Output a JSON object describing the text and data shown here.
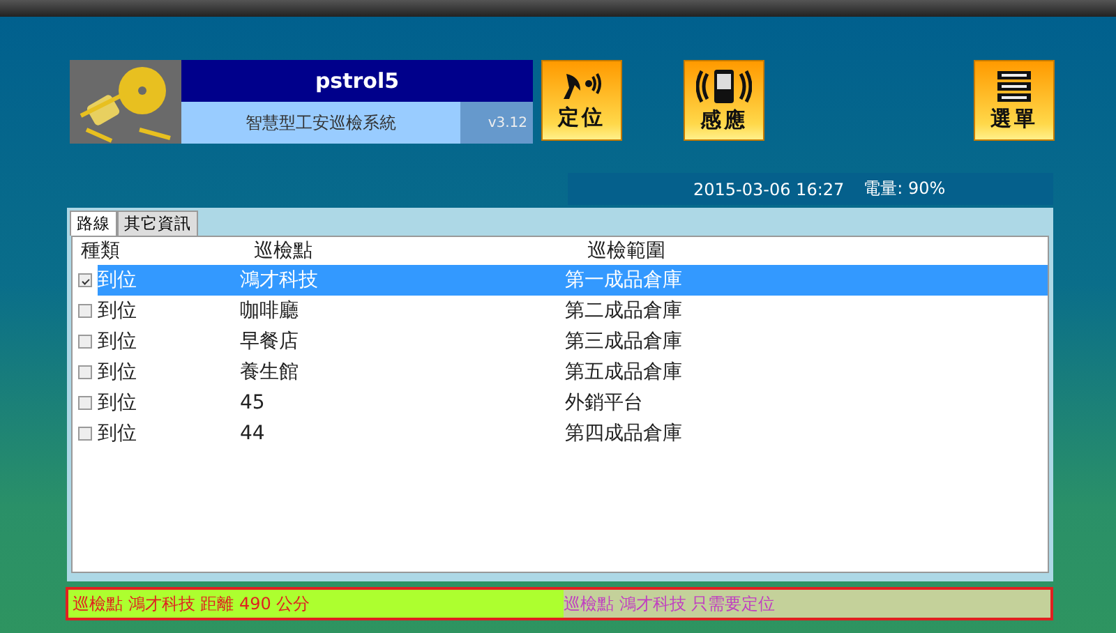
{
  "app": {
    "title": "pstrol5",
    "subtitle": "智慧型工安巡檢系統",
    "version": "v3.12"
  },
  "toolbar": [
    {
      "kind": "locate",
      "label": "定位"
    },
    {
      "kind": "sense",
      "label": "感應"
    },
    {
      "kind": "menu",
      "label": "選單"
    }
  ],
  "status": {
    "datetime": "2015-03-06 16:27",
    "battery": "電量: 90%"
  },
  "tabs": [
    {
      "label": "路線",
      "selected": true
    },
    {
      "label": "其它資訊",
      "selected": false
    }
  ],
  "table": {
    "columns": [
      "種類",
      "巡檢點",
      "巡檢範圍"
    ],
    "rows": [
      {
        "checked": true,
        "selected": true,
        "cells": [
          "到位",
          "鴻才科技",
          "第一成品倉庫"
        ]
      },
      {
        "checked": false,
        "selected": false,
        "cells": [
          "到位",
          "咖啡廳",
          "第二成品倉庫"
        ]
      },
      {
        "checked": false,
        "selected": false,
        "cells": [
          "到位",
          "早餐店",
          "第三成品倉庫"
        ]
      },
      {
        "checked": false,
        "selected": false,
        "cells": [
          "到位",
          "養生館",
          "第五成品倉庫"
        ]
      },
      {
        "checked": false,
        "selected": false,
        "cells": [
          "到位",
          "45",
          "外銷平台"
        ]
      },
      {
        "checked": false,
        "selected": false,
        "cells": [
          "到位",
          "44",
          "第四成品倉庫"
        ]
      }
    ]
  },
  "status_bar": {
    "left": "巡檢點 鴻才科技 距離 490 公分",
    "right": "巡檢點 鴻才科技 只需要定位"
  }
}
